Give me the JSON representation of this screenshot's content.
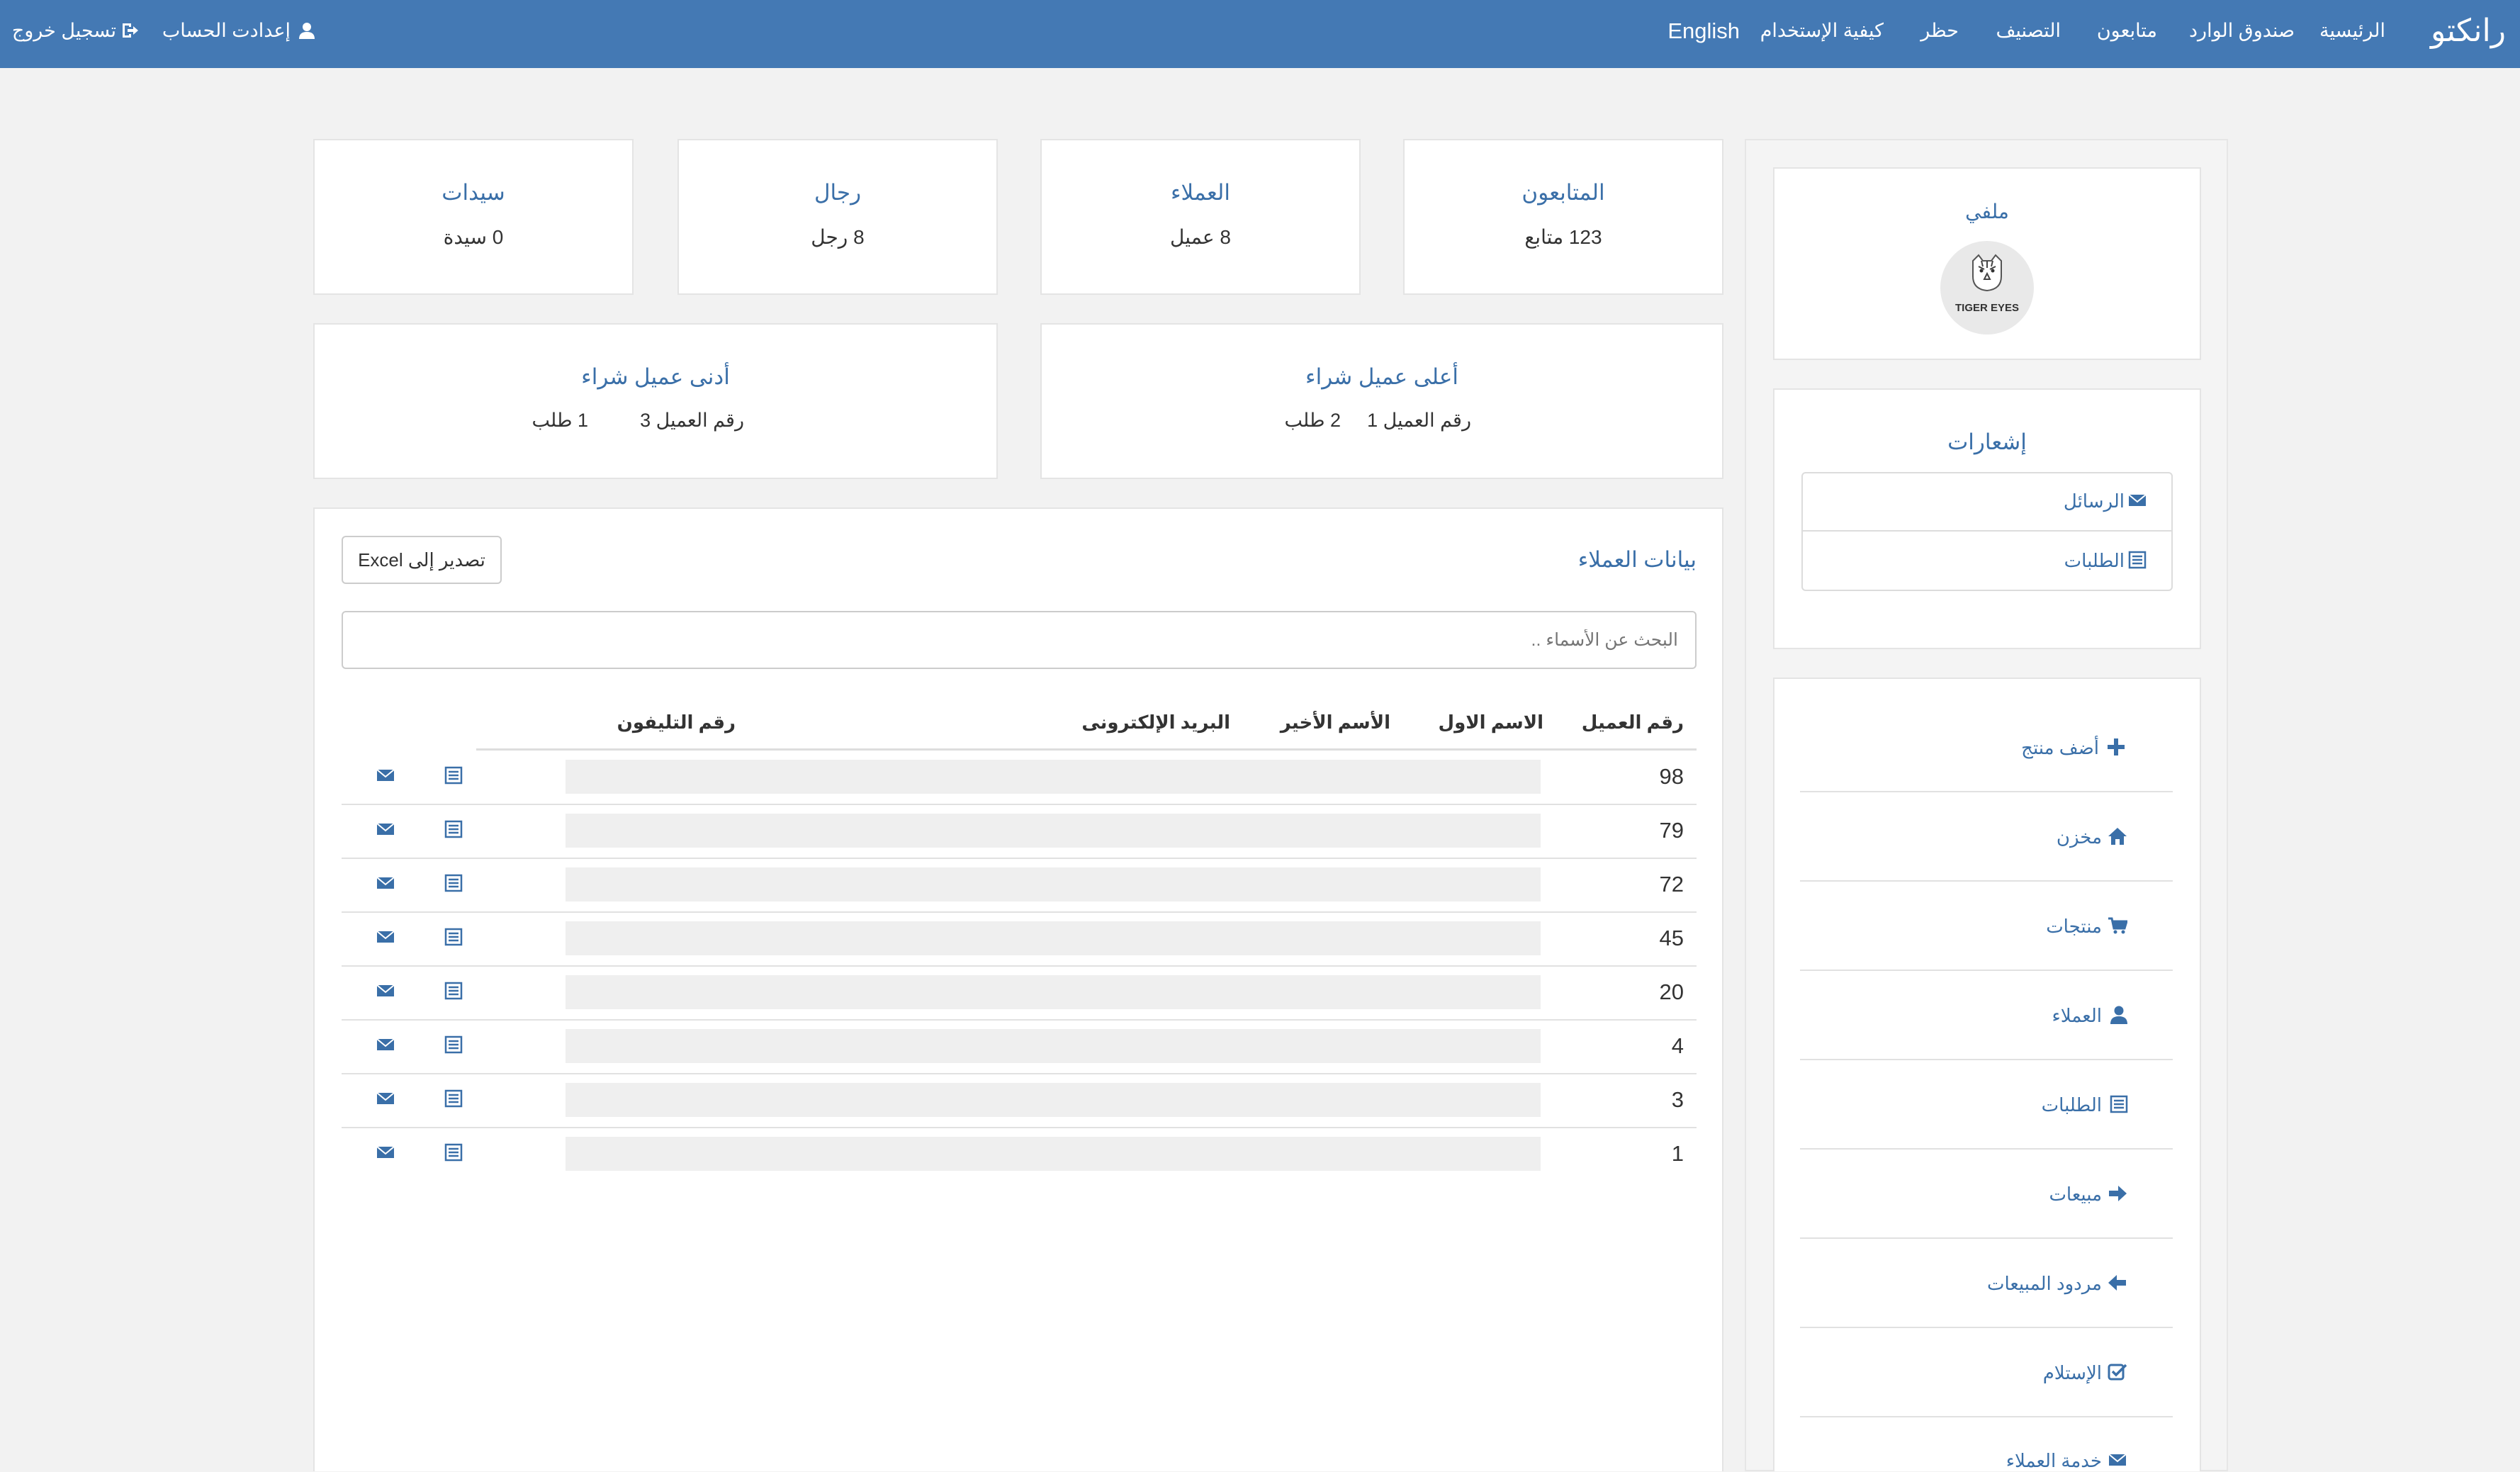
{
  "navbar": {
    "brand": "رانكتو",
    "items": [
      "الرئيسية",
      "صندوق الوارد",
      "متابعون",
      "التصنيف",
      "حظر",
      "كيفية الإستخدام",
      "English"
    ],
    "account_settings": "إعدادت الحساب",
    "logout": "تسجيل خروج"
  },
  "profile": {
    "title": "ملفي",
    "logo_text": "TIGER EYES"
  },
  "notifications": {
    "title": "إشعارات",
    "messages": "الرسائل",
    "orders": "الطلبات"
  },
  "side_menu": {
    "add_product": "أضف منتج",
    "warehouse": "مخزن",
    "products": "منتجات",
    "customers": "العملاء",
    "orders": "الطلبات",
    "sales": "مبيعات",
    "sales_returns": "مردود المبيعات",
    "receipt": "الإستلام",
    "customer_service": "خدمة العملاء"
  },
  "stats": {
    "followers": {
      "title": "المتابعون",
      "value": "123 متابع"
    },
    "customers": {
      "title": "العملاء",
      "value": "8 عميل"
    },
    "men": {
      "title": "رجال",
      "value": "8 رجل"
    },
    "women": {
      "title": "سيدات",
      "value": "0 سيدة"
    }
  },
  "top_buyer": {
    "title": "أعلى عميل شراء",
    "id": "رقم العميل 1",
    "orders": "2 طلب"
  },
  "bottom_buyer": {
    "title": "أدنى عميل شراء",
    "id": "رقم العميل 3",
    "orders": "1 طلب"
  },
  "customers_table": {
    "title": "بيانات العملاء",
    "export_label": "تصدير إلى Excel",
    "search_placeholder": "البحث عن الأسماء ..",
    "headers": {
      "id": "رقم العميل",
      "first_name": "الاسم الاول",
      "last_name": "الأسم الأخير",
      "email": "البريد الإلكترونى",
      "phone": "رقم التليفون"
    },
    "rows": [
      "98",
      "79",
      "72",
      "45",
      "20",
      "4",
      "3",
      "1"
    ]
  },
  "colors": {
    "navbar": "#4479b4",
    "link": "#3a6fa8",
    "background": "#f2f2f2"
  }
}
